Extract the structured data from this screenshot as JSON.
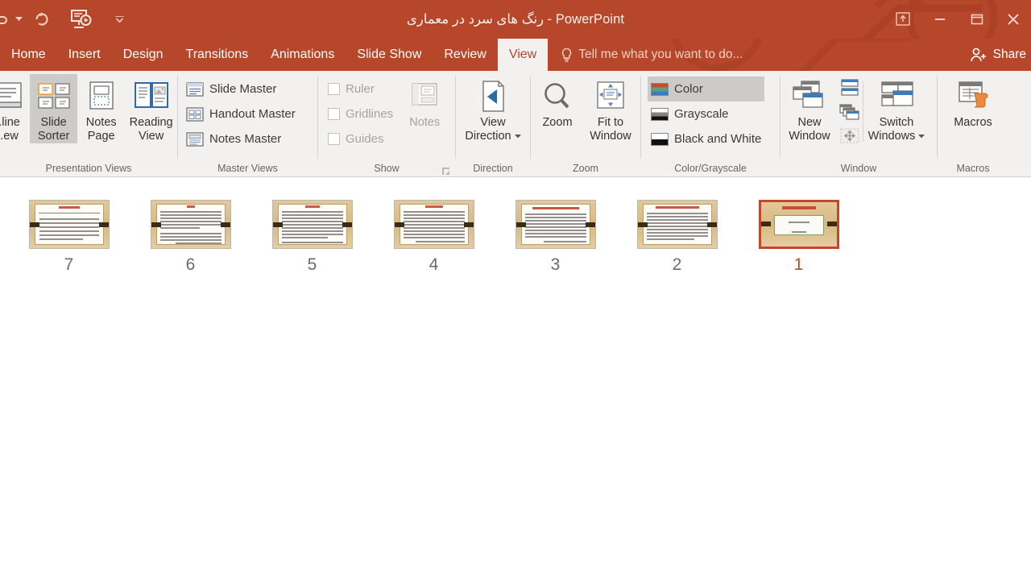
{
  "window": {
    "title": "رنگ های سرد در معماری - PowerPoint",
    "qat": [
      {
        "name": "undo-button",
        "icon": "undo-icon"
      },
      {
        "name": "undo-dropdown",
        "icon": "chevron-down-icon"
      },
      {
        "name": "redo-button",
        "icon": "redo-icon"
      },
      {
        "name": "start-from-beginning-button",
        "icon": "slideshow-icon"
      },
      {
        "name": "customize-quick-access-toolbar",
        "icon": "chevron-down-icon"
      }
    ],
    "controls": [
      {
        "name": "ribbon-display-options-button",
        "icon": "ribbon-display-icon"
      },
      {
        "name": "minimize-button",
        "icon": "minimize-icon"
      },
      {
        "name": "restore-button",
        "icon": "restore-icon"
      },
      {
        "name": "close-button",
        "icon": "close-icon"
      }
    ]
  },
  "tabs": [
    {
      "label": "Home",
      "active": false
    },
    {
      "label": "Insert",
      "active": false
    },
    {
      "label": "Design",
      "active": false
    },
    {
      "label": "Transitions",
      "active": false
    },
    {
      "label": "Animations",
      "active": false
    },
    {
      "label": "Slide Show",
      "active": false
    },
    {
      "label": "Review",
      "active": false
    },
    {
      "label": "View",
      "active": true
    }
  ],
  "tellme": {
    "placeholder": "Tell me what you want to do...",
    "icon": "lightbulb-icon"
  },
  "share": {
    "label": "Share",
    "icon": "share-person-icon"
  },
  "ribbon": {
    "groups": [
      {
        "label": "Presentation Views",
        "items": [
          {
            "label_line1": "...line",
            "label_line2": "...ew",
            "name": "outline-view-button",
            "selected": false
          },
          {
            "label_line1": "Slide",
            "label_line2": "Sorter",
            "name": "slide-sorter-button",
            "selected": true
          },
          {
            "label_line1": "Notes",
            "label_line2": "Page",
            "name": "notes-page-button",
            "selected": false
          },
          {
            "label_line1": "Reading",
            "label_line2": "View",
            "name": "reading-view-button",
            "selected": false
          }
        ]
      },
      {
        "label": "Master Views",
        "items": [
          {
            "label": "Slide Master",
            "name": "slide-master-button"
          },
          {
            "label": "Handout Master",
            "name": "handout-master-button"
          },
          {
            "label": "Notes Master",
            "name": "notes-master-button"
          }
        ]
      },
      {
        "label": "Show",
        "has_dialog_launcher": true,
        "checkboxes": [
          {
            "label": "Ruler",
            "checked": false,
            "disabled": true,
            "name": "ruler-checkbox"
          },
          {
            "label": "Gridlines",
            "checked": false,
            "disabled": true,
            "name": "gridlines-checkbox"
          },
          {
            "label": "Guides",
            "checked": false,
            "disabled": true,
            "name": "guides-checkbox"
          }
        ],
        "notes_button": {
          "label": "Notes",
          "disabled": true,
          "name": "notes-button"
        }
      },
      {
        "label": "Direction",
        "items": [
          {
            "label_line1": "View",
            "label_line2": "Direction",
            "name": "view-direction-button",
            "has_caret": true
          }
        ]
      },
      {
        "label": "Zoom",
        "items": [
          {
            "label_line1": "Zoom",
            "label_line2": "",
            "name": "zoom-button"
          },
          {
            "label_line1": "Fit to",
            "label_line2": "Window",
            "name": "fit-to-window-button"
          }
        ]
      },
      {
        "label": "Color/Grayscale",
        "items": [
          {
            "label": "Color",
            "name": "color-button",
            "selected": true
          },
          {
            "label": "Grayscale",
            "name": "grayscale-button",
            "selected": false
          },
          {
            "label": "Black and White",
            "name": "black-and-white-button",
            "selected": false
          }
        ]
      },
      {
        "label": "Window",
        "items": [
          {
            "label_line1": "New",
            "label_line2": "Window",
            "name": "new-window-button"
          },
          {
            "label_line1": "Switch",
            "label_line2": "Windows",
            "name": "switch-windows-button",
            "has_caret": true
          }
        ],
        "small_items": [
          {
            "name": "arrange-all-button"
          },
          {
            "name": "cascade-button"
          },
          {
            "name": "move-split-button",
            "disabled": true
          }
        ]
      },
      {
        "label": "Macros",
        "items": [
          {
            "label_line1": "Macros",
            "label_line2": "",
            "name": "macros-button"
          }
        ]
      }
    ]
  },
  "sorter": {
    "slides": [
      {
        "number": "7",
        "selected": false,
        "layout": "title-body"
      },
      {
        "number": "6",
        "selected": false,
        "layout": "body"
      },
      {
        "number": "5",
        "selected": false,
        "layout": "body"
      },
      {
        "number": "4",
        "selected": false,
        "layout": "body"
      },
      {
        "number": "3",
        "selected": false,
        "layout": "title-body"
      },
      {
        "number": "2",
        "selected": false,
        "layout": "title-body"
      },
      {
        "number": "1",
        "selected": true,
        "layout": "title-slide"
      }
    ]
  },
  "colors": {
    "accent": "#b7472a",
    "ribbon_bg": "#f2f1f0",
    "selected_tab_text": "#b7472a",
    "selection": "#cdcbc9"
  }
}
